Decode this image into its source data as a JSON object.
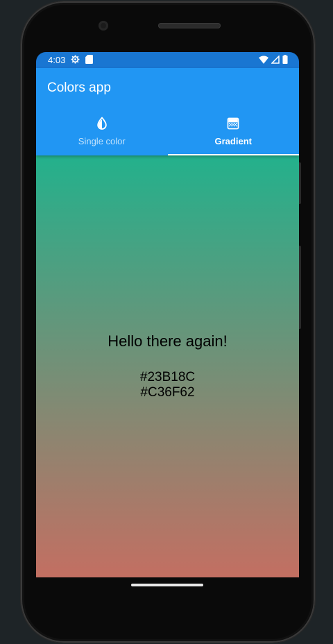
{
  "status_bar": {
    "time": "4:03",
    "left_icons": [
      "settings-icon",
      "sd-card-icon"
    ],
    "right_icons": [
      "wifi-icon",
      "signal-icon",
      "battery-icon"
    ]
  },
  "app_bar": {
    "title": "Colors app",
    "color": "#2196F3",
    "status_color": "#1976D2"
  },
  "tabs": [
    {
      "label": "Single color",
      "icon": "water-drop-icon",
      "selected": false
    },
    {
      "label": "Gradient",
      "icon": "gradient-icon",
      "selected": true
    }
  ],
  "content": {
    "greeting": "Hello there again!",
    "color_start": "#23B18C",
    "color_end": "#C36F62"
  }
}
